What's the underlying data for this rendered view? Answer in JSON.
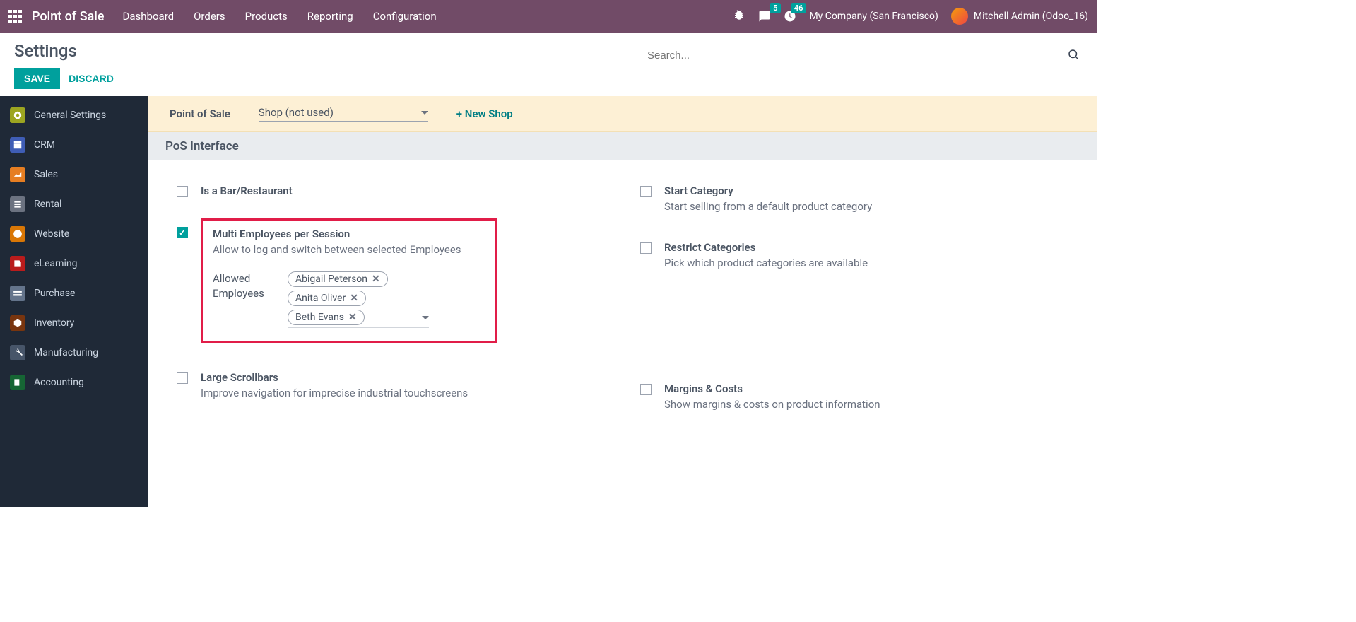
{
  "topnav": {
    "app_title": "Point of Sale",
    "menu": [
      "Dashboard",
      "Orders",
      "Products",
      "Reporting",
      "Configuration"
    ],
    "messages_badge": "5",
    "activities_badge": "46",
    "company": "My Company (San Francisco)",
    "user": "Mitchell Admin (Odoo_16)"
  },
  "control": {
    "title": "Settings",
    "save": "SAVE",
    "discard": "DISCARD",
    "search_placeholder": "Search..."
  },
  "sidebar": {
    "items": [
      {
        "label": "General Settings",
        "color": "#9ca521"
      },
      {
        "label": "CRM",
        "color": "#3f5db5"
      },
      {
        "label": "Sales",
        "color": "#e67e22"
      },
      {
        "label": "Rental",
        "color": "#6b7280"
      },
      {
        "label": "Website",
        "color": "#d97706"
      },
      {
        "label": "eLearning",
        "color": "#b91c1c"
      },
      {
        "label": "Purchase",
        "color": "#64748b"
      },
      {
        "label": "Inventory",
        "color": "#78350f"
      },
      {
        "label": "Manufacturing",
        "color": "#475569"
      },
      {
        "label": "Accounting",
        "color": "#166534"
      }
    ]
  },
  "yellow": {
    "label": "Point of Sale",
    "selected": "Shop (not used)",
    "new_shop": "+ New Shop"
  },
  "section": {
    "pos_interface": "PoS Interface"
  },
  "settings": {
    "bar_restaurant": {
      "label": "Is a Bar/Restaurant"
    },
    "multi_emp": {
      "label": "Multi Employees per Session",
      "desc": "Allow to log and switch between selected Employees",
      "allowed_label": "Allowed Employees",
      "tags": [
        "Abigail Peterson",
        "Anita Oliver",
        "Beth Evans"
      ]
    },
    "large_scroll": {
      "label": "Large Scrollbars",
      "desc": "Improve navigation for imprecise industrial touchscreens"
    },
    "start_cat": {
      "label": "Start Category",
      "desc": "Start selling from a default product category"
    },
    "restrict_cat": {
      "label": "Restrict Categories",
      "desc": "Pick which product categories are available"
    },
    "margins": {
      "label": "Margins & Costs",
      "desc": "Show margins & costs on product information"
    }
  }
}
